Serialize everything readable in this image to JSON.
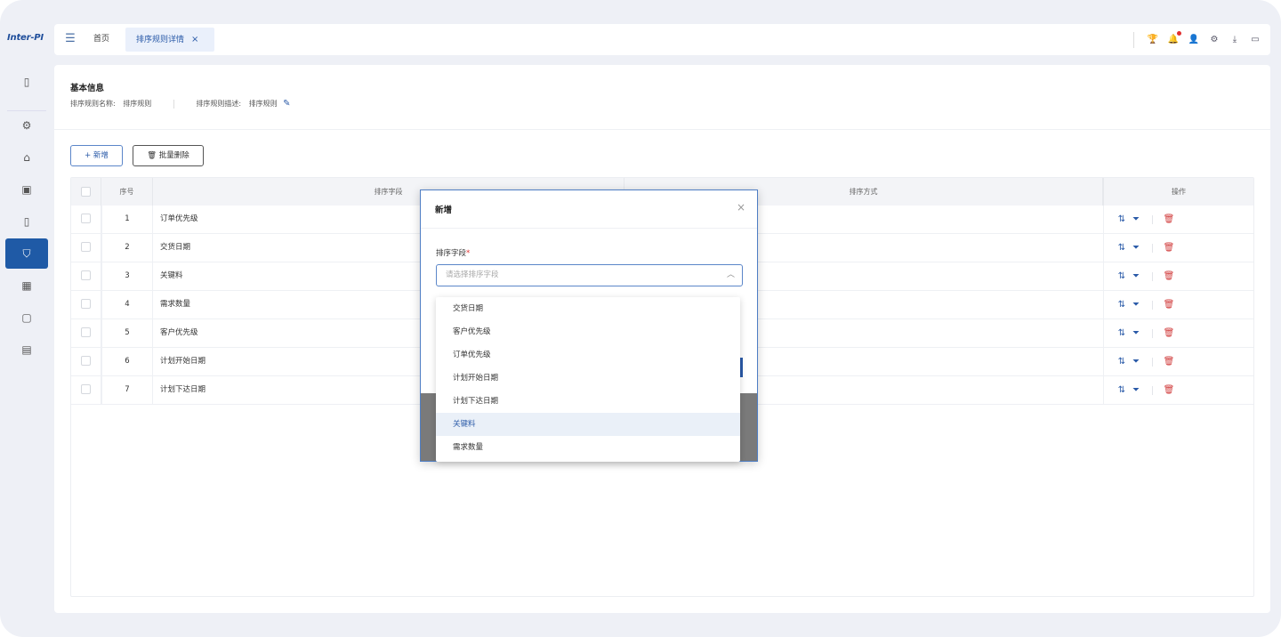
{
  "app": {
    "logo": "Inter-PI"
  },
  "topbar": {
    "tabs": [
      {
        "label": "首页"
      },
      {
        "label": "排序规则详情",
        "close": "×"
      }
    ],
    "icons": [
      "trophy-icon",
      "bell-icon",
      "user-icon",
      "settings-icon",
      "download-icon",
      "monitor-icon"
    ]
  },
  "rail": {
    "items": [
      "document-icon",
      "gear-icon",
      "building-icon",
      "calendar-icon",
      "file-icon",
      "shield-icon",
      "grid-icon",
      "screen-icon",
      "board-icon"
    ],
    "active_index": 5
  },
  "info": {
    "title": "基本信息",
    "name_label": "排序规则名称:",
    "name_value": "排序规则",
    "desc_label": "排序规则描述:",
    "desc_value": "排序规则"
  },
  "toolbar": {
    "add_label": "+ 新增",
    "batch_delete_label": "🗑 批量删除"
  },
  "table": {
    "headers": {
      "no": "序号",
      "field": "排序字段",
      "order": "排序方式",
      "ops": "操作"
    },
    "rows": [
      {
        "no": "1",
        "field": "订单优先级"
      },
      {
        "no": "2",
        "field": "交货日期"
      },
      {
        "no": "3",
        "field": "关键料"
      },
      {
        "no": "4",
        "field": "需求数量"
      },
      {
        "no": "5",
        "field": "客户优先级"
      },
      {
        "no": "6",
        "field": "计划开始日期"
      },
      {
        "no": "7",
        "field": "计划下达日期"
      }
    ]
  },
  "modal": {
    "title": "新增",
    "close": "×",
    "field_label": "排序字段",
    "required_mark": "*",
    "select_placeholder": "请选择排序字段",
    "options": [
      "交货日期",
      "客户优先级",
      "订单优先级",
      "计划开始日期",
      "计划下达日期",
      "关键料",
      "需求数量"
    ],
    "highlighted_option": "关键料"
  },
  "colors": {
    "accent": "#1f5aa6",
    "danger": "#d03a3a"
  }
}
